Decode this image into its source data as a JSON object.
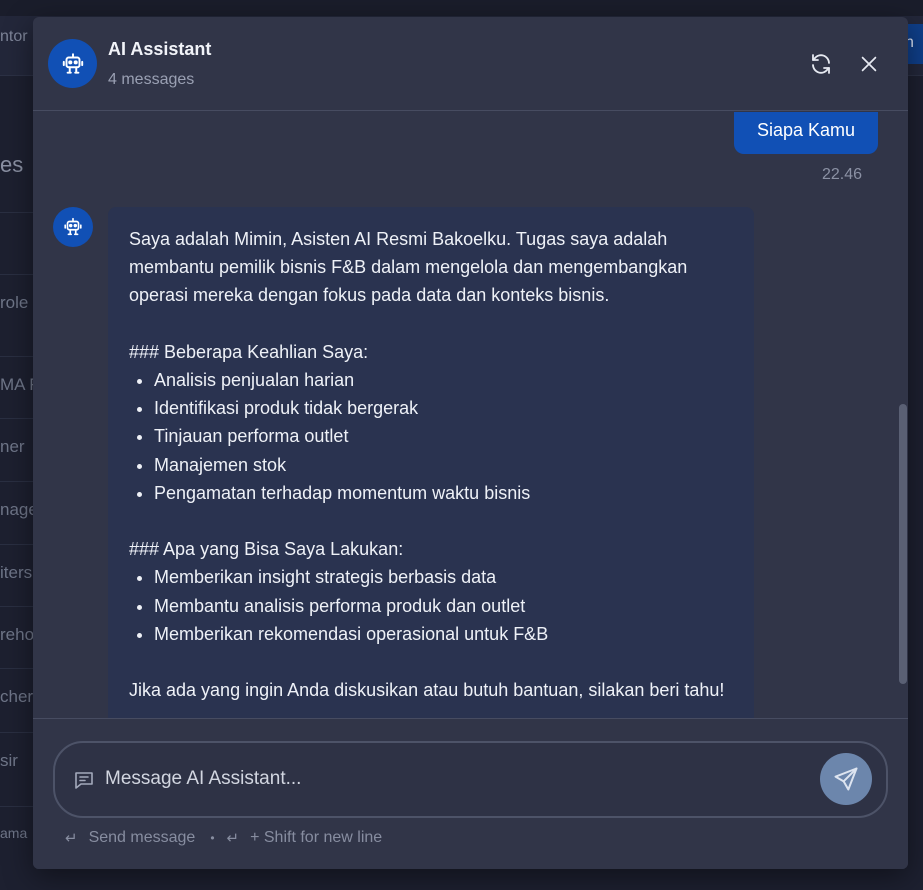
{
  "background": {
    "top_left_text": "ntor",
    "top_right_text": "n",
    "sidebar_items": [
      "es",
      "",
      "role",
      "MA R",
      "ner",
      "nage",
      "iters",
      "reho",
      "cher",
      "sir",
      "ama"
    ]
  },
  "chat": {
    "title": "AI Assistant",
    "subtitle": "4 messages",
    "header_icons": {
      "refresh": "refresh-icon",
      "close": "close-icon"
    },
    "user_message": {
      "text": "Siapa Kamu",
      "time": "22.46"
    },
    "ai_message": {
      "intro": "Saya adalah Mimin, Asisten AI Resmi Bakoelku. Tugas saya adalah membantu pemilik bisnis F&B dalam mengelola dan mengembangkan operasi mereka dengan fokus pada data dan konteks bisnis.",
      "section1_heading": "### Beberapa Keahlian Saya:",
      "section1_items": [
        "Analisis penjualan harian",
        "Identifikasi produk tidak bergerak",
        "Tinjauan performa outlet",
        "Manajemen stok",
        "Pengamatan terhadap momentum waktu bisnis"
      ],
      "section2_heading": "### Apa yang Bisa Saya Lakukan:",
      "section2_items": [
        "Memberikan insight strategis berbasis data",
        "Membantu analisis performa produk dan outlet",
        "Memberikan rekomendasi operasional untuk F&B"
      ],
      "closing": "Jika ada yang ingin Anda diskusikan atau butuh bantuan, silakan beri tahu!"
    },
    "input": {
      "placeholder": "Message AI Assistant...",
      "hint_send_key": "↵",
      "hint_send": "Send message",
      "hint_separator": "•",
      "hint_newline_key": "↵",
      "hint_newline": "+ Shift for new line"
    },
    "colors": {
      "accent": "#1150b5",
      "modal_bg": "#313548",
      "ai_bubble_bg": "#2a3350",
      "send_button": "#6c86ac"
    }
  }
}
